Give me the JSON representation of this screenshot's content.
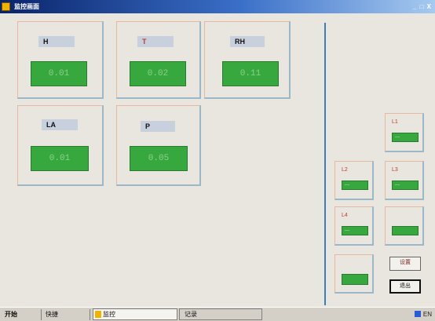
{
  "window": {
    "title": "监控画面",
    "controls": "_ □ X"
  },
  "panels": [
    {
      "label": "H",
      "value": "0.01"
    },
    {
      "label": "T",
      "value": "0.02"
    },
    {
      "label": "RH",
      "value": "0.11"
    },
    {
      "label": "LA",
      "value": "0.01"
    },
    {
      "label": "P",
      "value": "0.05"
    }
  ],
  "side_panels": [
    {
      "label": "L1",
      "value": "—"
    },
    {
      "label": "L2",
      "value": "—"
    },
    {
      "label": "L3",
      "value": "—"
    },
    {
      "label": "L4",
      "value": "—"
    },
    {
      "label": "",
      "value": ""
    },
    {
      "label": "",
      "value": ""
    }
  ],
  "buttons": {
    "first": "设置",
    "second": "退出"
  },
  "taskbar": {
    "start": "开始",
    "quick": "快捷",
    "active_window": "监控",
    "second_window": "记录",
    "tray": "EN"
  },
  "colors": {
    "value_green": "#37a83e",
    "label_bg": "#c7d0dc",
    "divider": "#3e7fb2",
    "title_blue": "#0a246a"
  }
}
